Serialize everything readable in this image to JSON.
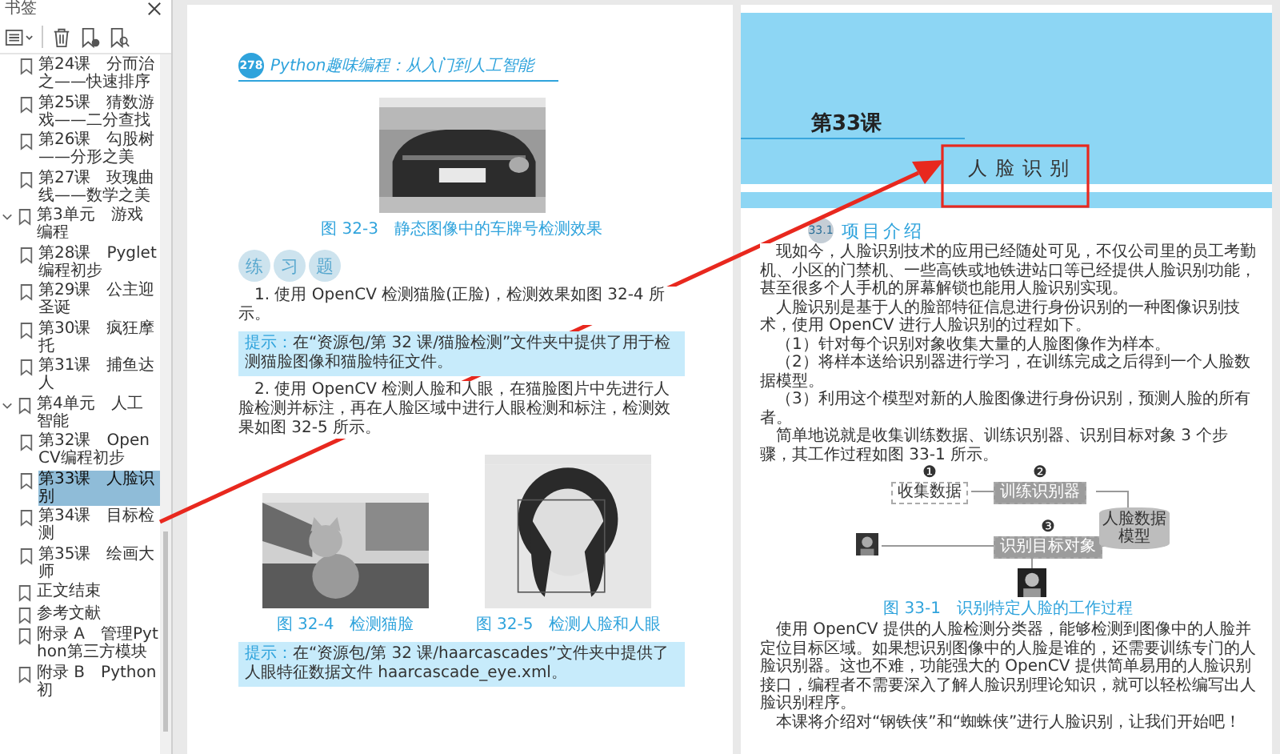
{
  "sidebar": {
    "title": "书签",
    "items": [
      {
        "children": [
          {
            "label": "第24课　分而治之——快速排序",
            "selected": false
          },
          {
            "label": "第25课　猜数游戏——二分查找",
            "selected": false
          },
          {
            "label": "第26课　勾股树——分形之美",
            "selected": false
          },
          {
            "label": "第27课　玫瑰曲线——数学之美",
            "selected": false
          }
        ]
      },
      {
        "label": "第3单元　游戏编程",
        "selected": false,
        "expanded": true,
        "children": [
          {
            "label": "第28课　Pyglet编程初步",
            "selected": false
          },
          {
            "label": "第29课　公主迎圣诞",
            "selected": false
          },
          {
            "label": "第30课　疯狂摩托",
            "selected": false
          },
          {
            "label": "第31课　捕鱼达人",
            "selected": false
          }
        ]
      },
      {
        "label": "第4单元　人工智能",
        "selected": false,
        "expanded": true,
        "children": [
          {
            "label": "第32课　OpenCV编程初步",
            "selected": false
          },
          {
            "label": "第33课　人脸识别",
            "selected": true
          },
          {
            "label": "第34课　目标检测",
            "selected": false
          },
          {
            "label": "第35课　绘画大师",
            "selected": false
          }
        ]
      },
      {
        "label": "正文结束",
        "selected": false
      },
      {
        "label": "参考文献",
        "selected": false
      },
      {
        "label": "附录 A　管理Python第三方模块",
        "selected": false
      },
      {
        "label": "附录 B　Python初",
        "selected": false
      }
    ]
  },
  "left_page": {
    "page_number": "278",
    "header": "Python趣味编程：从入门到人工智能",
    "blocks": [
      {
        "kind": "figure",
        "figures": [
          {
            "caption": "图 32-3　静态图像中的车牌号检测效果"
          }
        ]
      },
      {
        "kind": "exercise_title",
        "chars": [
          "练",
          "习",
          "题"
        ]
      },
      {
        "kind": "paragraph",
        "text": "1. 使用 OpenCV 检测猫脸(正脸)，检测效果如图 32-4 所示。"
      },
      {
        "kind": "tip",
        "label": "提示：",
        "text": "在“资源包/第 32 课/猫脸检测”文件夹中提供了用于检测猫脸图像和猫脸特征文件。"
      },
      {
        "kind": "paragraph",
        "text": "2. 使用 OpenCV 检测人脸和人眼，在猫脸图片中先进行人脸检测并标注，再在人脸区域中进行人眼检测和标注，检测效果如图 32-5 所示。"
      },
      {
        "kind": "figure",
        "figures": [
          {
            "caption": "图 32-4　检测猫脸"
          },
          {
            "caption": "图 32-5　检测人脸和人眼"
          }
        ]
      },
      {
        "kind": "tip",
        "label": "提示：",
        "text": "在“资源包/第 32 课/haarcascades”文件夹中提供了人眼特征数据文件 haarcascade_eye.xml。"
      }
    ]
  },
  "right_page": {
    "lesson": "第33课",
    "title": "人脸识别",
    "blocks": [
      {
        "kind": "section",
        "number": "33.1",
        "text": "项目介绍"
      },
      {
        "kind": "paragraph",
        "text": "现如今，人脸识别技术的应用已经随处可见，不仅公司里的员工考勤机、小区的门禁机、一些高铁或地铁进站口等已经提供人脸识别功能，甚至很多个人手机的屏幕解锁也能用人脸识别实现。"
      },
      {
        "kind": "paragraph",
        "text": "人脸识别是基于人的脸部特征信息进行身份识别的一种图像识别技术，使用 OpenCV 进行人脸识别的过程如下。"
      },
      {
        "kind": "paragraph",
        "text": "（1）针对每个识别对象收集大量的人脸图像作为样本。"
      },
      {
        "kind": "paragraph",
        "text": "（2）将样本送给识别器进行学习，在训练完成之后得到一个人脸数据模型。"
      },
      {
        "kind": "paragraph",
        "text": "（3）利用这个模型对新的人脸图像进行身份识别，预测人脸的所有者。"
      },
      {
        "kind": "paragraph",
        "text": "简单地说就是收集训练数据、训练识别器、识别目标对象 3 个步骤，其工作过程如图 33-1 所示。"
      },
      {
        "kind": "diagram",
        "steps": [
          {
            "number": "❶",
            "label": "收集数据"
          },
          {
            "number": "❷",
            "label": "训练识别器"
          },
          {
            "number": "❸",
            "label": "识别目标对象"
          }
        ],
        "store": "人脸数据模型",
        "caption": "图 33-1　识别特定人脸的工作过程"
      },
      {
        "kind": "paragraph",
        "text": "使用 OpenCV 提供的人脸检测分类器，能够检测到图像中的人脸并定位目标区域。如果想识别图像中的人脸是谁的，还需要训练专门的人脸识别器。这也不难，功能强大的 OpenCV 提供简单易用的人脸识别接口，编程者不需要深入了解人脸识别理论知识，就可以轻松编写出人脸识别程序。"
      },
      {
        "kind": "paragraph",
        "text": "本课将介绍对“钢铁侠”和“蜘蛛侠”进行人脸识别，让我们开始吧！"
      }
    ]
  }
}
